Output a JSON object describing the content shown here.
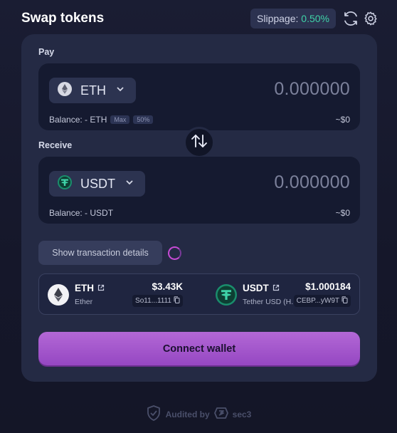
{
  "header": {
    "title": "Swap tokens",
    "slippage_label": "Slippage:",
    "slippage_value": "0.50%"
  },
  "pay": {
    "label": "Pay",
    "token": "ETH",
    "amount_placeholder": "0.000000",
    "balance": "Balance: - ETH",
    "max_label": "Max",
    "half_label": "50%",
    "usd": "~$0"
  },
  "receive": {
    "label": "Receive",
    "token": "USDT",
    "amount_placeholder": "0.000000",
    "balance": "Balance: - USDT",
    "usd": "~$0"
  },
  "details": {
    "button_label": "Show transaction details"
  },
  "info": {
    "eth": {
      "symbol": "ETH",
      "name": "Ether",
      "price": "$3.43K",
      "address": "So11...1111"
    },
    "usdt": {
      "symbol": "USDT",
      "name": "Tether USD (H...",
      "price": "$1.000184",
      "address": "CEBP...yW9T"
    }
  },
  "connect_label": "Connect wallet",
  "footer": {
    "audited_by": "Audited by",
    "auditor": "sec3"
  },
  "colors": {
    "accent": "#3fd3a8",
    "button": "#b368d6",
    "card": "#242a44"
  }
}
